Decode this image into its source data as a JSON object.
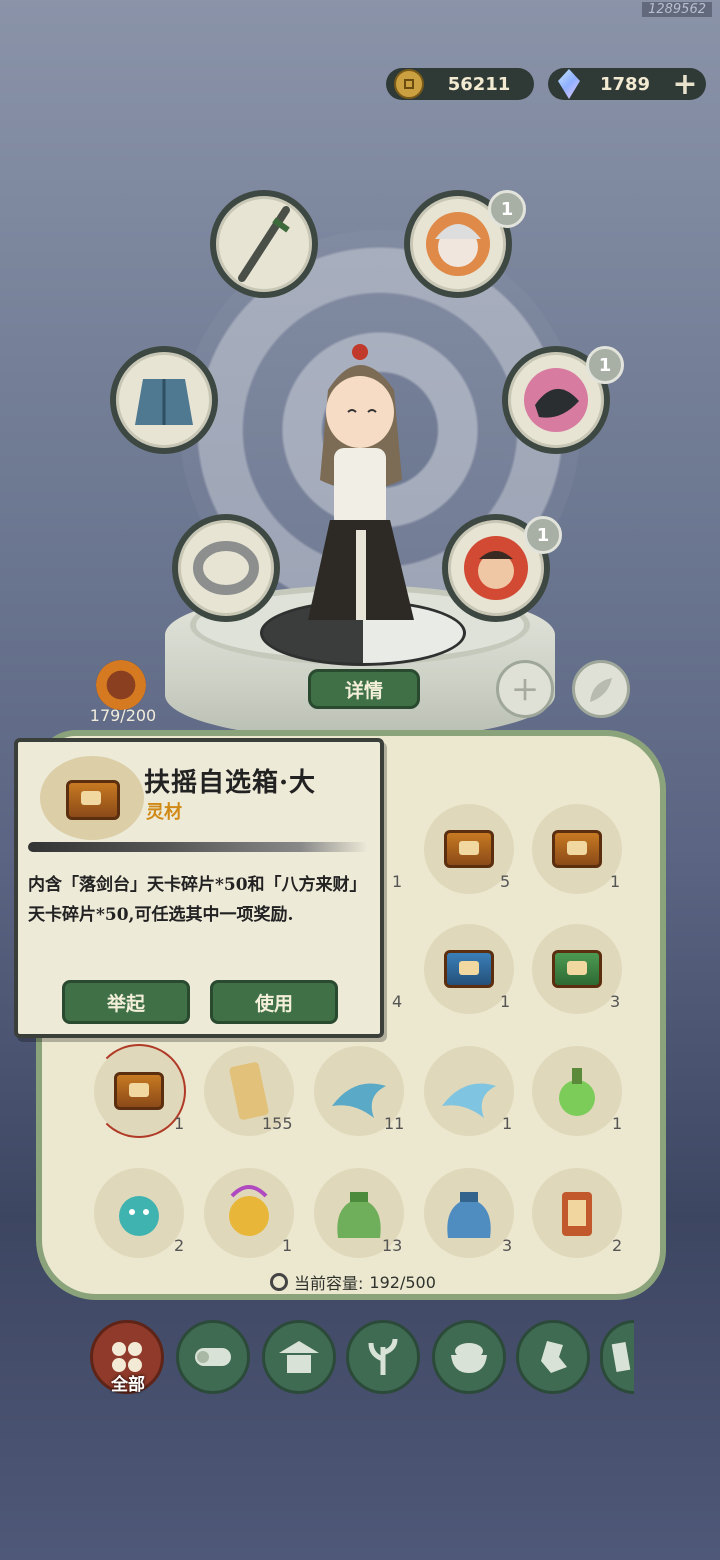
{
  "watermark": "1289562",
  "currency": {
    "coins": "56211",
    "gems": "1789",
    "coin_icon": "copper-coin-icon",
    "gem_icon": "crystal-gem-icon",
    "add_icon": "plus-icon"
  },
  "equipment": {
    "slots": [
      {
        "name": "weapon-slot",
        "icon": "sword-icon"
      },
      {
        "name": "companion-slot-1",
        "icon": "white-haired-companion-icon",
        "badge": "1"
      },
      {
        "name": "armor-slot",
        "icon": "robe-armor-icon"
      },
      {
        "name": "companion-slot-2",
        "icon": "dragon-pet-icon",
        "badge": "1"
      },
      {
        "name": "ring-slot",
        "icon": "ring-icon"
      },
      {
        "name": "companion-slot-3",
        "icon": "red-face-companion-icon",
        "badge": "1"
      }
    ],
    "detail_button": "详情",
    "level": "179/200",
    "add_icon": "plus-icon",
    "feather_icon": "feather-icon"
  },
  "popup": {
    "title": "扶摇自选箱·大",
    "category": "灵材",
    "description": "内含「落剑台」天卡碎片*50和「八方来财」天卡碎片*50,可任选其中一项奖励.",
    "raise_button": "举起",
    "use_button": "使用"
  },
  "inventory": {
    "row1": [
      "1",
      "5",
      "1"
    ],
    "row2": [
      "4",
      "1",
      "3"
    ],
    "row3": [
      "1",
      "155",
      "11",
      "1",
      "1"
    ],
    "row4": [
      "2",
      "1",
      "13",
      "3",
      "2"
    ],
    "capacity_label": "当前容量:",
    "capacity_value": "192/500"
  },
  "tabs": {
    "active_label": "全部"
  },
  "colors": {
    "button_green": "#3f7046",
    "panel_border": "#8ba37a",
    "active_tab": "#8f3a2a",
    "category_orange": "#d08a18"
  }
}
